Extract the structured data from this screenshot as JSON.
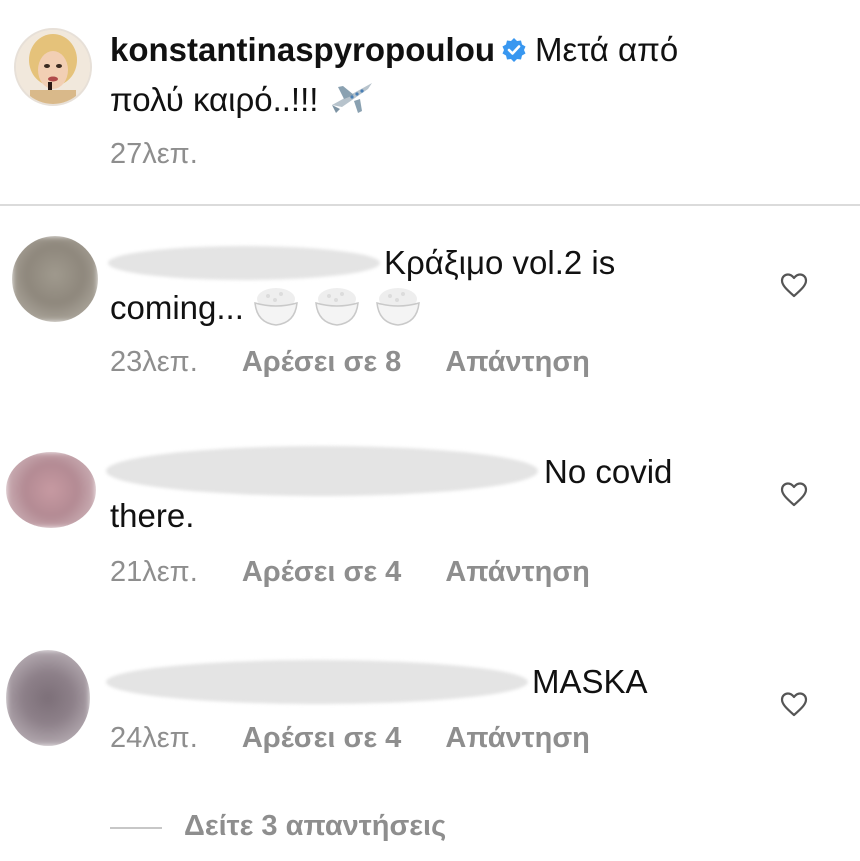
{
  "post": {
    "username": "konstantinaspyropoulou",
    "caption_line1": "Μετά από",
    "caption_line2": "πολύ καιρό..!!!",
    "time": "27λεπ."
  },
  "comments": [
    {
      "text_line1": "Κράξιμο vol.2 is",
      "text_line2": "coming...",
      "time": "23λεπ.",
      "likes": "Αρέσει σε 8",
      "reply": "Απάντηση"
    },
    {
      "text_line1": "No covid",
      "text_line2": "there.",
      "time": "21λεπ.",
      "likes": "Αρέσει σε 4",
      "reply": "Απάντηση"
    },
    {
      "text_line1": "MASKA",
      "time": "24λεπ.",
      "likes": "Αρέσει σε 4",
      "reply": "Απάντηση"
    }
  ],
  "view_replies": "Δείτε 3 απαντήσεις",
  "colors": {
    "verified": "#3897f0",
    "meta": "#8e8e8e",
    "text": "#111111"
  },
  "icons": [
    "verified-badge-icon",
    "airplane-emoji",
    "rice-bowl-emoji",
    "heart-icon"
  ]
}
